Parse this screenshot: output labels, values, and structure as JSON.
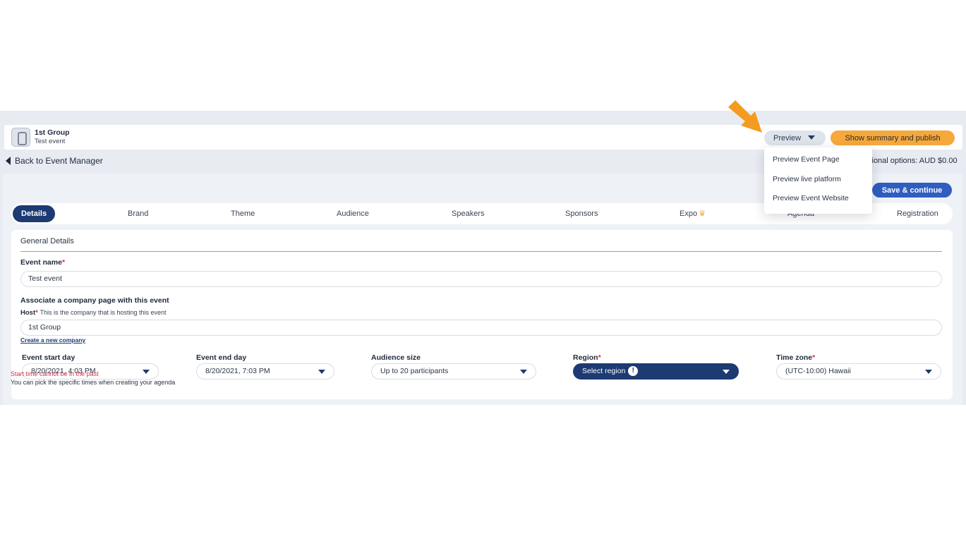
{
  "header": {
    "group_name": "1st Group",
    "event_name": "Test event",
    "preview_label": "Preview",
    "publish_label": "Show summary and publish"
  },
  "nav": {
    "back_label": "Back to Event Manager",
    "options_text": "itional options: AUD $0.00",
    "save_label": "Save & continue"
  },
  "tabs": [
    {
      "label": "Details"
    },
    {
      "label": "Brand"
    },
    {
      "label": "Theme"
    },
    {
      "label": "Audience"
    },
    {
      "label": "Speakers"
    },
    {
      "label": "Sponsors"
    },
    {
      "label": "Expo"
    },
    {
      "label": "Agenda"
    },
    {
      "label": "Registration"
    }
  ],
  "form": {
    "section_title": "General Details",
    "event_name_label": "Event name",
    "event_name_value": "Test event",
    "associate_label": "Associate a company page with this event",
    "host_label": "Host",
    "host_note": "This is the company that is hosting this event",
    "host_value": "1st Group",
    "create_company_link": "Create a new company",
    "start_label": "Event start day",
    "start_value": "8/20/2021, 4:03 PM",
    "end_label": "Event end day",
    "end_value": "8/20/2021, 7:03 PM",
    "audience_label": "Audience size",
    "audience_value": "Up to 20 participants",
    "region_label": "Region",
    "region_value": "Select region",
    "timezone_label": "Time zone",
    "timezone_value": "(UTC-10:00) Hawaii",
    "error_text": "Start time cannot be in the past",
    "hint_text": "You can pick the specific times when creating your agenda",
    "required_mark": "*",
    "info_mark": "!"
  },
  "preview_menu": {
    "items": [
      "Preview Event Page",
      "Preview live platform",
      "Preview Event Website"
    ]
  },
  "colors": {
    "accent_orange": "#f6a83a",
    "navy": "#1d3a72",
    "blue": "#2f5dc0",
    "error_red": "#d0344a",
    "arrow": "#f39c1f"
  }
}
